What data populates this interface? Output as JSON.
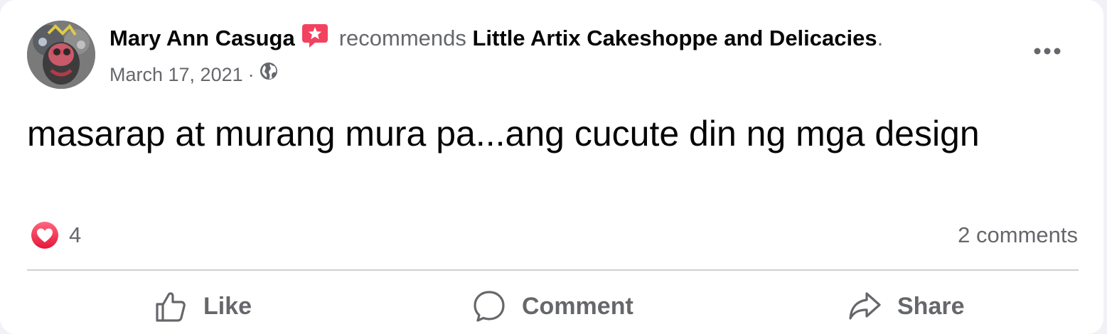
{
  "post": {
    "author": "Mary Ann Casuga",
    "recommends_text": "recommends",
    "page_name": "Little Artix Cakeshoppe and Delicacies",
    "period": ".",
    "date": "March 17, 2021",
    "separator": "·",
    "privacy_icon": "globe-icon",
    "body": "masarap at murang mura pa...ang cucute din ng mga design"
  },
  "reactions": {
    "icon": "love-reaction-icon",
    "count": "4",
    "comments": "2 comments"
  },
  "actions": {
    "like": "Like",
    "comment": "Comment",
    "share": "Share"
  },
  "colors": {
    "love": "#f33e58",
    "badge": "#f3425f",
    "secondary_text": "#65676b",
    "primary_text": "#050505"
  }
}
